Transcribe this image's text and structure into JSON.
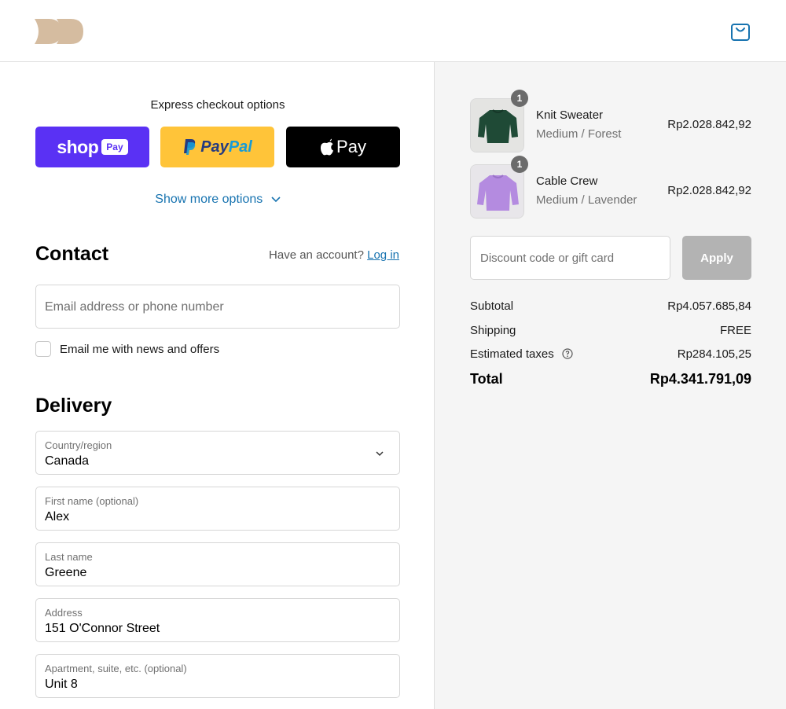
{
  "header": {
    "logo_icon": "brand-logo-icon",
    "cart_icon": "shopping-bag-icon",
    "logo_color": "#d5bca0",
    "cart_color": "#1773b0"
  },
  "express": {
    "title": "Express checkout options",
    "shop_pay": {
      "word": "shop",
      "pill": "Pay",
      "color": "#5a31f4"
    },
    "paypal": {
      "pay": "Pay",
      "pal": "Pal",
      "color": "#ffc439"
    },
    "apple_pay": {
      "word": "Pay",
      "icon": "apple-icon",
      "color": "#000000"
    },
    "show_more": "Show more options"
  },
  "contact": {
    "title": "Contact",
    "account_prompt": "Have an account?",
    "login_label": "Log in",
    "email_placeholder": "Email address or phone number",
    "newsletter_label": "Email me with news and offers",
    "newsletter_checked": false
  },
  "delivery": {
    "title": "Delivery",
    "country": {
      "label": "Country/region",
      "value": "Canada"
    },
    "first_name": {
      "label": "First name (optional)",
      "value": "Alex"
    },
    "last_name": {
      "label": "Last name",
      "value": "Greene"
    },
    "address": {
      "label": "Address",
      "value": "151 O'Connor Street"
    },
    "apartment": {
      "label": "Apartment, suite, etc. (optional)",
      "value": "Unit 8"
    }
  },
  "cart": {
    "items": [
      {
        "name": "Knit Sweater",
        "variant": "Medium / Forest",
        "price": "Rp2.028.842,92",
        "quantity": "1",
        "swatch": "#1f4a36"
      },
      {
        "name": "Cable Crew",
        "variant": "Medium / Lavender",
        "price": "Rp2.028.842,92",
        "quantity": "1",
        "swatch": "#b48be0"
      }
    ],
    "discount_placeholder": "Discount code or gift card",
    "apply_label": "Apply"
  },
  "summary": {
    "subtotal_label": "Subtotal",
    "subtotal_value": "Rp4.057.685,84",
    "shipping_label": "Shipping",
    "shipping_value": "FREE",
    "taxes_label": "Estimated taxes",
    "taxes_value": "Rp284.105,25",
    "total_label": "Total",
    "total_value": "Rp4.341.791,09"
  }
}
